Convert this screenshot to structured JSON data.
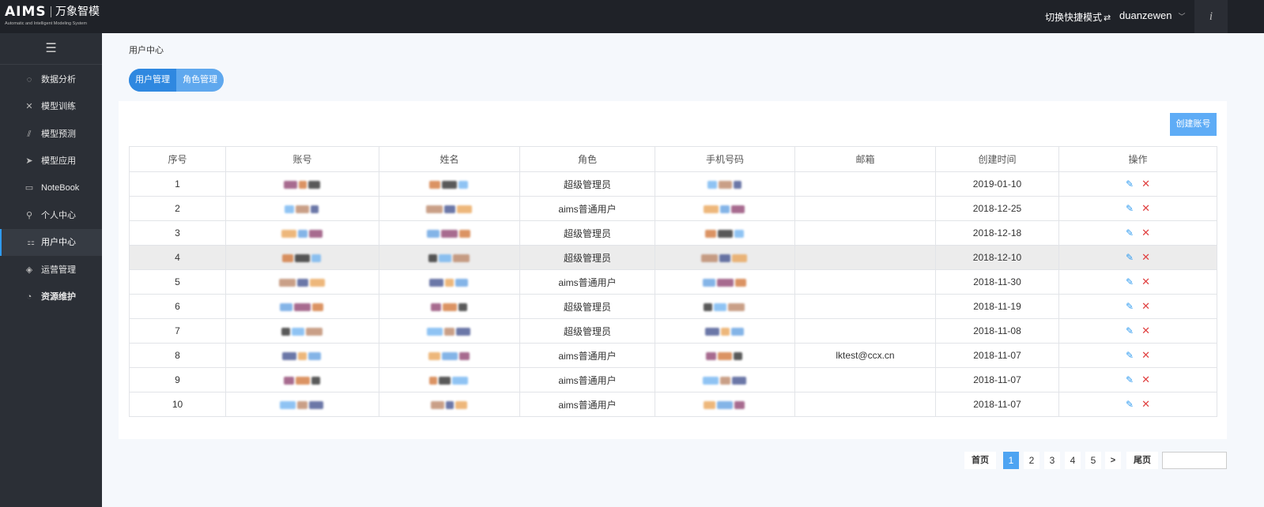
{
  "app": {
    "logo_mark": "AIMS",
    "logo_name": "万象智模",
    "logo_subtitle": "Automatic and Intelligent Modeling System",
    "mode_switch": "切换快捷模式",
    "username": "duanzewen",
    "info_label": "i"
  },
  "sidebar": {
    "items": [
      {
        "label": "数据分析",
        "icon": "data-analysis-icon",
        "glyph": "◌"
      },
      {
        "label": "模型训练",
        "icon": "model-training-icon",
        "glyph": "✕"
      },
      {
        "label": "模型预测",
        "icon": "model-predict-icon",
        "glyph": "⫽"
      },
      {
        "label": "模型应用",
        "icon": "model-apply-icon",
        "glyph": "➤"
      },
      {
        "label": "NoteBook",
        "icon": "notebook-icon",
        "glyph": "▭"
      },
      {
        "label": "个人中心",
        "icon": "person-icon",
        "glyph": "⚲"
      },
      {
        "label": "用户中心",
        "icon": "user-center-icon",
        "glyph": "⚏"
      },
      {
        "label": "运营管理",
        "icon": "operations-icon",
        "glyph": "◈"
      },
      {
        "label": "资源维护",
        "icon": "resource-icon",
        "glyph": "◔"
      }
    ]
  },
  "breadcrumb": "用户中心",
  "tabs": [
    {
      "label": "用户管理"
    },
    {
      "label": "角色管理"
    }
  ],
  "create_button": "创建账号",
  "table": {
    "columns": [
      "序号",
      "账号",
      "姓名",
      "角色",
      "手机号码",
      "邮箱",
      "创建时间",
      "操作"
    ],
    "rows": [
      {
        "no": "1",
        "role": "超级管理员",
        "email": "",
        "created": "2019-01-10"
      },
      {
        "no": "2",
        "role": "aims普通用户",
        "email": "",
        "created": "2018-12-25"
      },
      {
        "no": "3",
        "role": "超级管理员",
        "email": "",
        "created": "2018-12-18"
      },
      {
        "no": "4",
        "role": "超级管理员",
        "email": "",
        "created": "2018-12-10"
      },
      {
        "no": "5",
        "role": "aims普通用户",
        "email": "",
        "created": "2018-11-30"
      },
      {
        "no": "6",
        "role": "超级管理员",
        "email": "",
        "created": "2018-11-19"
      },
      {
        "no": "7",
        "role": "超级管理员",
        "email": "",
        "created": "2018-11-08"
      },
      {
        "no": "8",
        "role": "aims普通用户",
        "email": "lktest@ccx.cn",
        "created": "2018-11-07"
      },
      {
        "no": "9",
        "role": "aims普通用户",
        "email": "",
        "created": "2018-11-07"
      },
      {
        "no": "10",
        "role": "aims普通用户",
        "email": "",
        "created": "2018-11-07"
      }
    ],
    "highlighted_row": 4,
    "edit_glyph": "✎",
    "delete_glyph": "✕"
  },
  "pagination": {
    "first": "首页",
    "pages": [
      "1",
      "2",
      "3",
      "4",
      "5"
    ],
    "current": "1",
    "next": ">",
    "last": "尾页",
    "jump_value": ""
  },
  "colors": {
    "accent": "#2f9bf0",
    "header_bg": "#1f2228",
    "sidebar_bg": "#2b2f36",
    "delete": "#e04040"
  }
}
